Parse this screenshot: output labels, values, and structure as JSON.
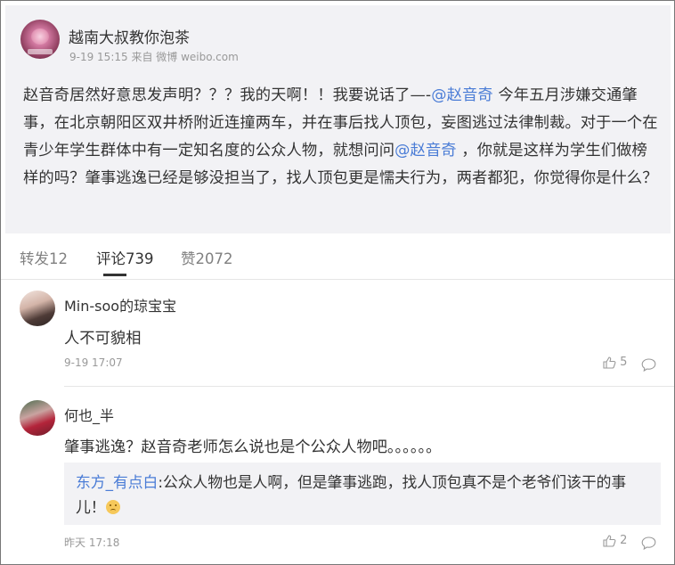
{
  "post": {
    "author": "越南大叔教你泡茶",
    "meta": "9-19 15:15 来自 微博 weibo.com",
    "text_1": "赵音奇居然好意思发声明？？？我的天啊！！我要说话了—-",
    "mention_1": "@赵音奇",
    "text_2": " 今年五月涉嫌交通肇事，在北京朝阳区双井桥附近连撞两车，并在事后找人顶包，妄图逃过法律制裁。对于一个在青少年学生群体中有一定知名度的公众人物，就想问问",
    "mention_2": "@赵音奇",
    "text_3": " ，你就是这样为学生们做榜样的吗？肇事逃逸已经是够没担当了，找人顶包更是懦夫行为，两者都犯，你觉得你是什么？"
  },
  "tabs": [
    {
      "label": "转发12"
    },
    {
      "label": "评论739"
    },
    {
      "label": "赞2072"
    }
  ],
  "comments": [
    {
      "name": "Min-soo的琼宝宝",
      "text": "人不可貌相",
      "time": "9-19 17:07",
      "likes": "5"
    },
    {
      "name": "何也_半",
      "text": "肇事逃逸？赵音奇老师怎么说也是个公众人物吧。。。。。。",
      "time": "昨天 17:18",
      "likes": "2",
      "reply_author": "东方_有点白",
      "reply_text": ":公众人物也是人啊，但是肇事逃跑，找人顶包真不是个老爷们该干的事儿！"
    }
  ],
  "icons": {
    "like": "thumbs-up-icon",
    "comment": "comment-bubble-icon",
    "emoji": "awkward-face-emoji"
  },
  "colors": {
    "link": "#4a7cd6",
    "post_bg": "#f2f2f5"
  }
}
